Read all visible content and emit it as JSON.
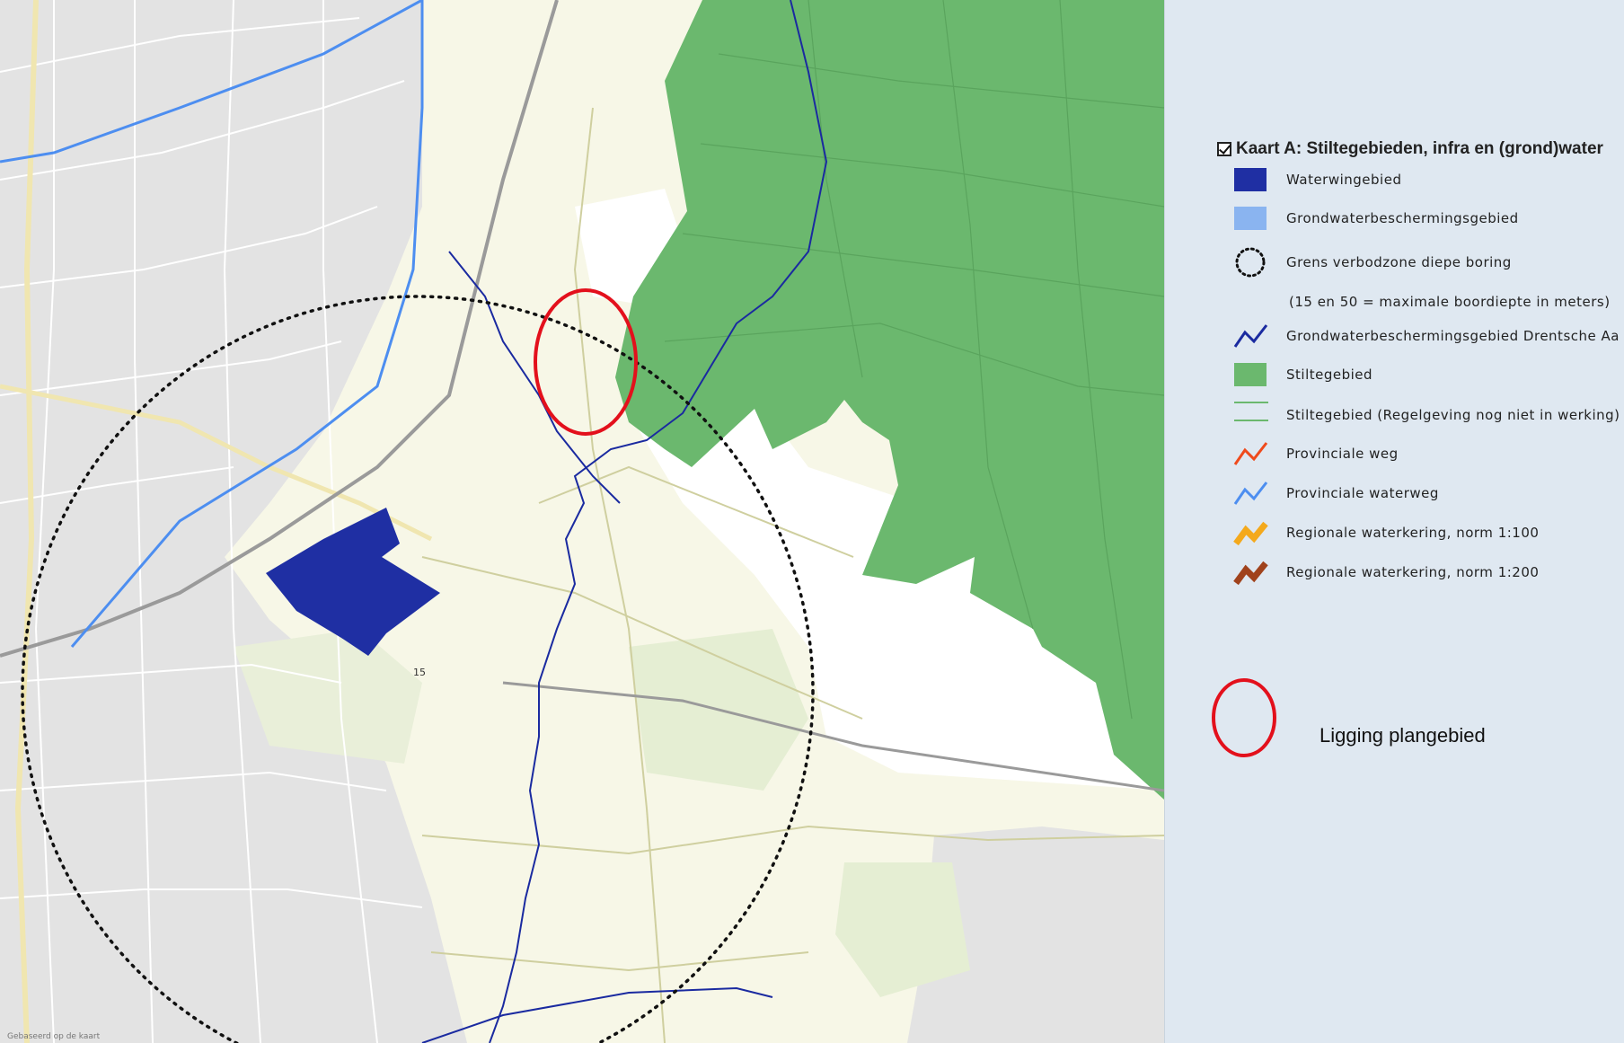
{
  "map": {
    "label_15": "15",
    "attribution": "Gebaseerd op de kaart"
  },
  "colors": {
    "map_background": "#f7f7e7",
    "stiltegebied": "#6bb86e",
    "waterwingebied": "#1f2fa3",
    "grondwaterbeschermingsgebied": "#8ab4f0",
    "drentsche_aa": "#1a2aa0",
    "provinciale_weg": "#ef4a1c",
    "provinciale_waterweg": "#4d8ef0",
    "waterkering_100": "#f4a91c",
    "waterkering_200": "#a0421c",
    "plangebied_circle": "#e3101c",
    "panel_background": "#dfe8f1"
  },
  "legend": {
    "title": "Kaart A: Stiltegebieden, infra en (grond)water",
    "checked": true,
    "items": [
      {
        "label": "Waterwingebied",
        "symbol": "fill-dark-blue"
      },
      {
        "label": "Grondwaterbeschermingsgebied",
        "symbol": "fill-light-blue"
      },
      {
        "label": "Grens verbodzone diepe boring",
        "symbol": "dotted-circle"
      },
      {
        "label": "Grondwaterbeschermingsgebied Drentsche Aa",
        "symbol": "line-navy"
      },
      {
        "label": "Stiltegebied",
        "symbol": "fill-green"
      },
      {
        "label": "Stiltegebied (Regelgeving nog niet in werking)",
        "symbol": "line-green"
      },
      {
        "label": "Provinciale weg",
        "symbol": "line-orange-red"
      },
      {
        "label": "Provinciale waterweg",
        "symbol": "line-blue"
      },
      {
        "label": "Regionale waterkering, norm 1:100",
        "symbol": "thick-line-orange"
      },
      {
        "label": "Regionale waterkering, norm 1:200",
        "symbol": "thick-line-brown"
      }
    ],
    "note": "(15 en 50 = maximale boordiepte in meters)",
    "plangebied_label": "Ligging plangebied"
  }
}
